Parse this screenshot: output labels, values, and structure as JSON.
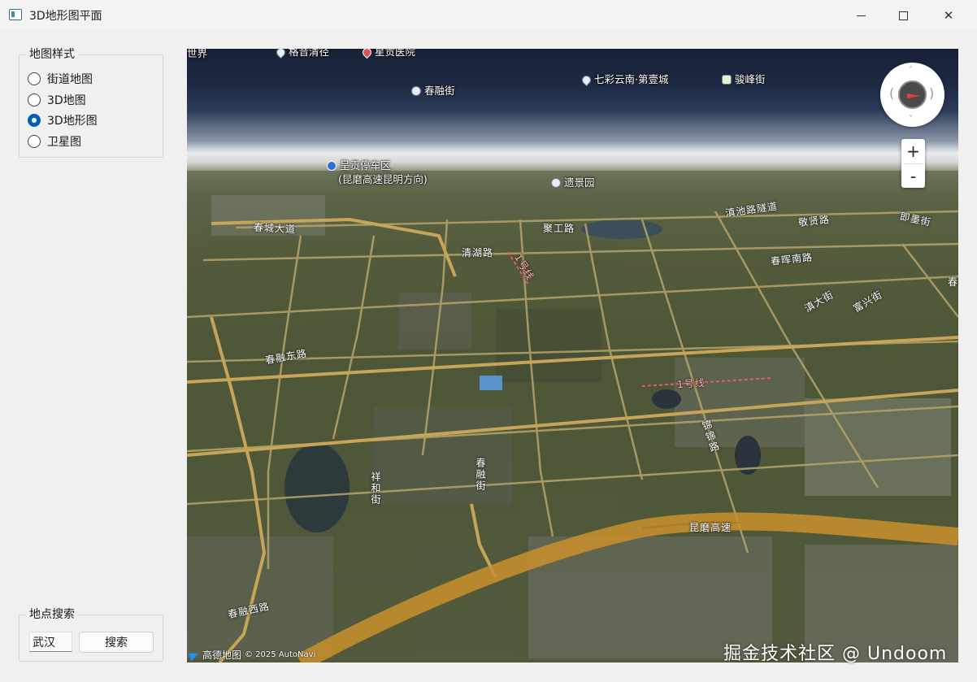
{
  "window": {
    "title": "3D地形图平面",
    "controls": {
      "minimize": "—",
      "maximize": "□",
      "close": "✕"
    }
  },
  "map_style": {
    "group_title": "地图样式",
    "options": [
      {
        "label": "街道地图",
        "checked": false
      },
      {
        "label": "3D地图",
        "checked": false
      },
      {
        "label": "3D地形图",
        "checked": true
      },
      {
        "label": "卫星图",
        "checked": false
      }
    ]
  },
  "location_search": {
    "group_title": "地点搜索",
    "input_value": "武汉",
    "button_label": "搜索"
  },
  "map": {
    "pois": [
      {
        "label": "世界",
        "icon": "none"
      },
      {
        "label": "格音清径",
        "icon": "pin"
      },
      {
        "label": "星贡医院",
        "icon": "pin-red"
      },
      {
        "label": "春融街",
        "icon": "dot"
      },
      {
        "label": "七彩云南·第壹城",
        "icon": "pin"
      },
      {
        "label": "骏峰街",
        "icon": "bus-badge"
      },
      {
        "label": "呈贡停车区",
        "icon": "parking"
      },
      {
        "label": "(昆磨高速昆明方向)",
        "icon": "none"
      },
      {
        "label": "遗景园",
        "icon": "dot"
      }
    ],
    "roads": [
      "春城大道",
      "聚工路",
      "滇池路隧道",
      "敬贤路",
      "即墨街",
      "清湖路",
      "1号线",
      "春晖南路",
      "滇大街",
      "富兴街",
      "春融东路",
      "1号线",
      "锦锦路",
      "春融街",
      "祥和街",
      "昆磨高速",
      "春融西路",
      "春"
    ],
    "compass": "compass-icon",
    "zoom_in": "+",
    "zoom_out": "-",
    "logo_text": "高德地图",
    "copyright": "© 2025 AutoNavi"
  },
  "watermark": "掘金技术社区 @ Undoom"
}
